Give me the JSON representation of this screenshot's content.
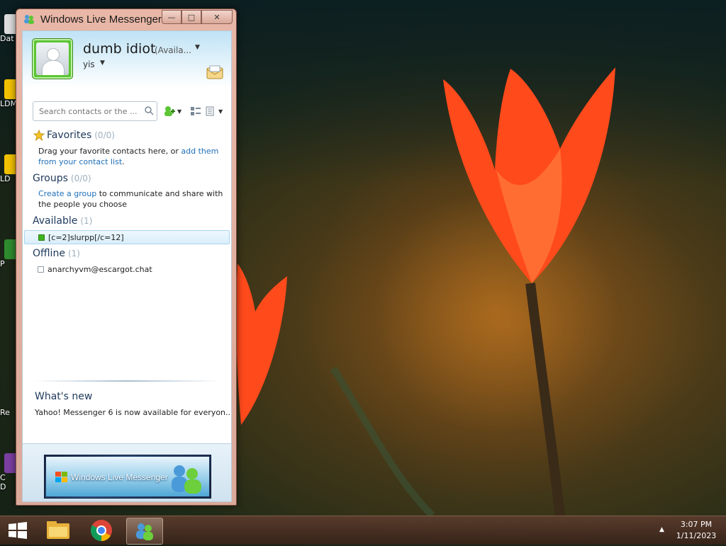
{
  "desktop": {
    "icons": [
      {
        "label": "Dat"
      },
      {
        "label": "LDM"
      },
      {
        "label": "LD"
      },
      {
        "label": "P"
      },
      {
        "label": "Re"
      },
      {
        "label": "C"
      },
      {
        "label": "D"
      }
    ]
  },
  "window": {
    "title": "Windows Live Messenger",
    "controls": {
      "minimize": "—",
      "maximize": "□",
      "close": "✕"
    }
  },
  "profile": {
    "display_name": "dumb idiot",
    "status": "(Availa...",
    "personal_message": "yis"
  },
  "search": {
    "placeholder": "Search contacts or the ..."
  },
  "sections": {
    "favorites": {
      "title": "Favorites",
      "count": "(0/0)",
      "desc_text": "Drag your favorite contacts here, or ",
      "desc_link": "add them from your contact list",
      "desc_end": "."
    },
    "groups": {
      "title": "Groups",
      "count": "(0/0)",
      "link": "Create a group",
      "desc_text": " to communicate and share with the people you choose"
    },
    "available": {
      "title": "Available",
      "count": "(1)",
      "contacts": [
        "[c=2]slurpp[/c=12]"
      ]
    },
    "offline": {
      "title": "Offline",
      "count": "(1)",
      "contacts": [
        "anarchyvm@escargot.chat"
      ]
    }
  },
  "whats_new": {
    "title": "What's new",
    "item": "Yahoo! Messenger 6 is now available for everyon..."
  },
  "ad": {
    "text": "Windows Live Messenger"
  },
  "taskbar": {
    "time": "3:07 PM",
    "date": "1/11/2023"
  },
  "colors": {
    "status_online": "#3fb31e",
    "link": "#1f6fb8",
    "heading": "#1e395b"
  }
}
